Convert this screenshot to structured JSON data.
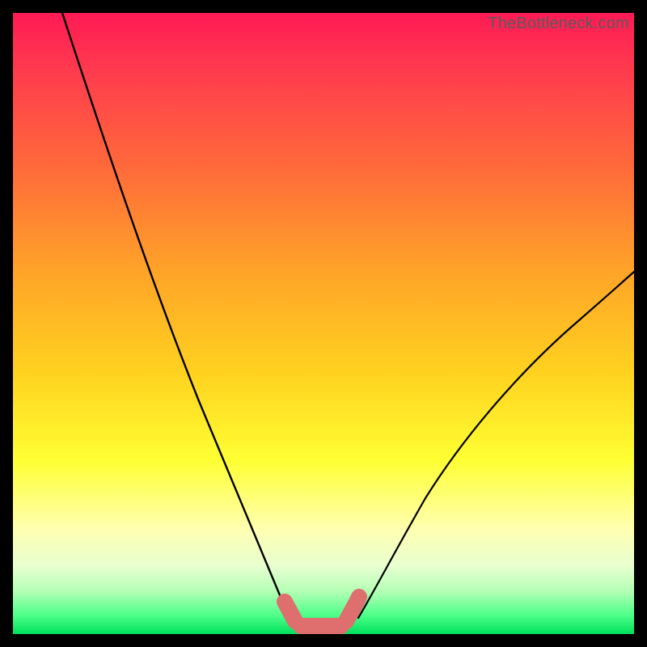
{
  "watermark": "TheBottleneck.com",
  "chart_data": {
    "type": "line",
    "title": "",
    "xlabel": "",
    "ylabel": "",
    "xlim": [
      0,
      100
    ],
    "ylim": [
      0,
      100
    ],
    "grid": false,
    "legend": false,
    "series": [
      {
        "name": "left-curve",
        "x": [
          8,
          12,
          16,
          20,
          24,
          28,
          32,
          35,
          37,
          39,
          41,
          43,
          44.5,
          45.5
        ],
        "y": [
          100,
          88,
          76,
          64,
          52,
          41,
          30,
          21,
          15,
          10,
          6.5,
          4,
          2.8,
          2.2
        ]
      },
      {
        "name": "right-curve",
        "x": [
          54,
          56,
          58,
          62,
          66,
          70,
          75,
          80,
          85,
          90,
          95,
          100
        ],
        "y": [
          2.5,
          4,
          6,
          10,
          15,
          20,
          26,
          32,
          38,
          44,
          50,
          56
        ]
      },
      {
        "name": "bottom-marker-band",
        "x": [
          44,
          45,
          46,
          48,
          50,
          52,
          53.5,
          54.5,
          55.5
        ],
        "y": [
          3.5,
          2.5,
          1.8,
          1.3,
          1.1,
          1.3,
          2.0,
          3.2,
          5.0
        ]
      }
    ],
    "background_gradient": {
      "orientation": "vertical",
      "stops": [
        {
          "pos": 0.0,
          "color": "#ff1a55"
        },
        {
          "pos": 0.25,
          "color": "#ff6a3a"
        },
        {
          "pos": 0.58,
          "color": "#ffd21f"
        },
        {
          "pos": 0.83,
          "color": "#ffffb0"
        },
        {
          "pos": 0.97,
          "color": "#4dff88"
        },
        {
          "pos": 1.0,
          "color": "#00e05c"
        }
      ]
    },
    "marker_style": {
      "color": "#e06b6b",
      "size": 20,
      "linewidth": 20,
      "capsule": true
    }
  }
}
